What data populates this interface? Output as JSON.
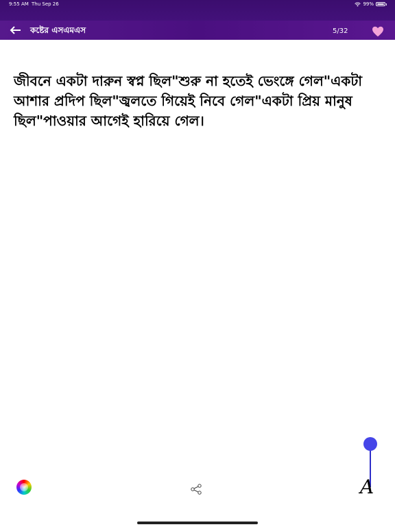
{
  "status_bar": {
    "time": "9:55 AM",
    "date": "Thu Sep 26",
    "battery": "99%"
  },
  "header": {
    "title": "কষ্টের এসএমএস",
    "counter": "5/32",
    "back_icon": "arrow-left-icon",
    "favorite_icon": "heart-icon"
  },
  "message": {
    "text": "জীবনে একটা দারুন স্বপ্ন ছিল\"শুরু না হতেই ভেংঙ্গে গেল\"একটা আশার প্রদিপ ছিল\"জ্বলতে গিয়েই নিবে গেল\"একটা প্রিয় মানুষ ছিল\"পাওয়ার আগেই হারিয়ে গেল।"
  },
  "toolbar": {
    "color_icon": "color-wheel-icon",
    "share_icon": "share-icon",
    "font_size_label": "A",
    "font_size_level": 0.0
  },
  "colors": {
    "header": "#4a0f80",
    "heart": "#f4a3d8",
    "slider": "#4545e8"
  }
}
